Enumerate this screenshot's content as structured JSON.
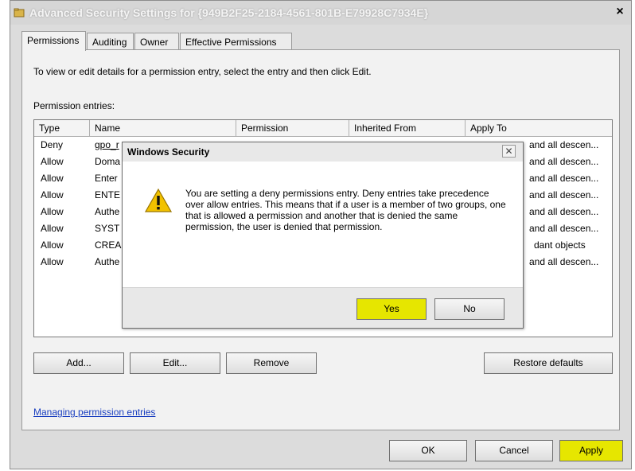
{
  "window": {
    "title": "Advanced Security Settings for {949B2F25-2184-4561-801B-E79928C7934E}",
    "close_glyph": "×"
  },
  "tabs": [
    "Permissions",
    "Auditing",
    "Owner",
    "Effective Permissions"
  ],
  "panel": {
    "instruction": "To view or edit details for a permission entry, select the entry and then click Edit.",
    "entries_label": "Permission entries:",
    "columns": [
      "Type",
      "Name",
      "Permission",
      "Inherited From",
      "Apply To"
    ],
    "rows": [
      {
        "type": "Deny",
        "name": "gpo_r",
        "apply_to": "and all descen..."
      },
      {
        "type": "Allow",
        "name": "Doma",
        "apply_to": "and all descen..."
      },
      {
        "type": "Allow",
        "name": "Enter",
        "apply_to": "and all descen..."
      },
      {
        "type": "Allow",
        "name": "ENTE",
        "apply_to": "and all descen..."
      },
      {
        "type": "Allow",
        "name": "Authe",
        "apply_to": "and all descen..."
      },
      {
        "type": "Allow",
        "name": "SYST",
        "apply_to": "and all descen..."
      },
      {
        "type": "Allow",
        "name": "CREA",
        "apply_to": "dant objects"
      },
      {
        "type": "Allow",
        "name": "Authe",
        "apply_to": "and all descen..."
      }
    ],
    "buttons": {
      "add": "Add...",
      "edit": "Edit...",
      "remove": "Remove",
      "restore": "Restore defaults"
    },
    "link": "Managing permission entries"
  },
  "footer": {
    "ok": "OK",
    "cancel": "Cancel",
    "apply": "Apply"
  },
  "dialog": {
    "title": "Windows Security",
    "close_glyph": "✕",
    "icon": "warning-icon",
    "message": "You are setting a deny permissions entry. Deny entries take precedence over allow entries. This means that if a user is a member of two groups, one that is allowed a permission and another that is denied the same permission, the user is denied that permission.",
    "yes": "Yes",
    "no": "No"
  },
  "colors": {
    "highlight": "#e6e600",
    "link": "#1a3fc0"
  }
}
